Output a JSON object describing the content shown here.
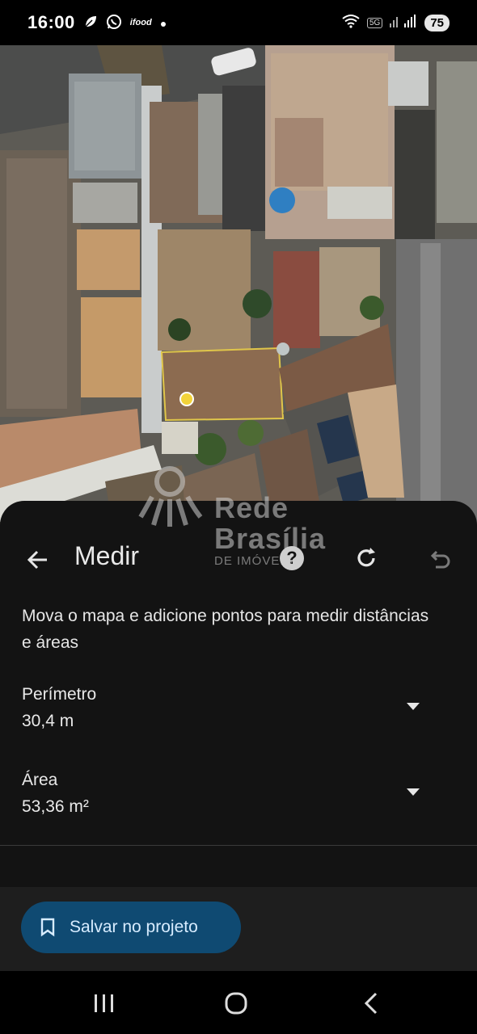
{
  "status_bar": {
    "time": "16:00",
    "icons": [
      "leaf-icon",
      "whatsapp-icon",
      "ifood-icon",
      "dot-icon"
    ],
    "ifood_label": "ifood",
    "network_label": "5G",
    "battery": "75"
  },
  "map": {
    "type": "satellite"
  },
  "watermark": {
    "line1": "Rede",
    "line2": "Brasília",
    "line3": "DE IMÓVEIS"
  },
  "sheet": {
    "title": "Medir",
    "help_label": "?",
    "instructions": "Mova o mapa e adicione pontos para medir distâncias e áreas",
    "metrics": [
      {
        "label": "Perímetro",
        "value": "30,4 m"
      },
      {
        "label": "Área",
        "value": "53,36 m²"
      }
    ],
    "save_button": "Salvar no projeto"
  },
  "colors": {
    "sheet_background": "#131313",
    "save_button_bg": "#0f4a72",
    "save_button_text": "#d7ecff",
    "measure_point": "#f2d33a",
    "measure_outline": "#e0c64a"
  },
  "nav_bar": {
    "icons": [
      "recent-apps-icon",
      "home-icon",
      "back-icon"
    ]
  }
}
